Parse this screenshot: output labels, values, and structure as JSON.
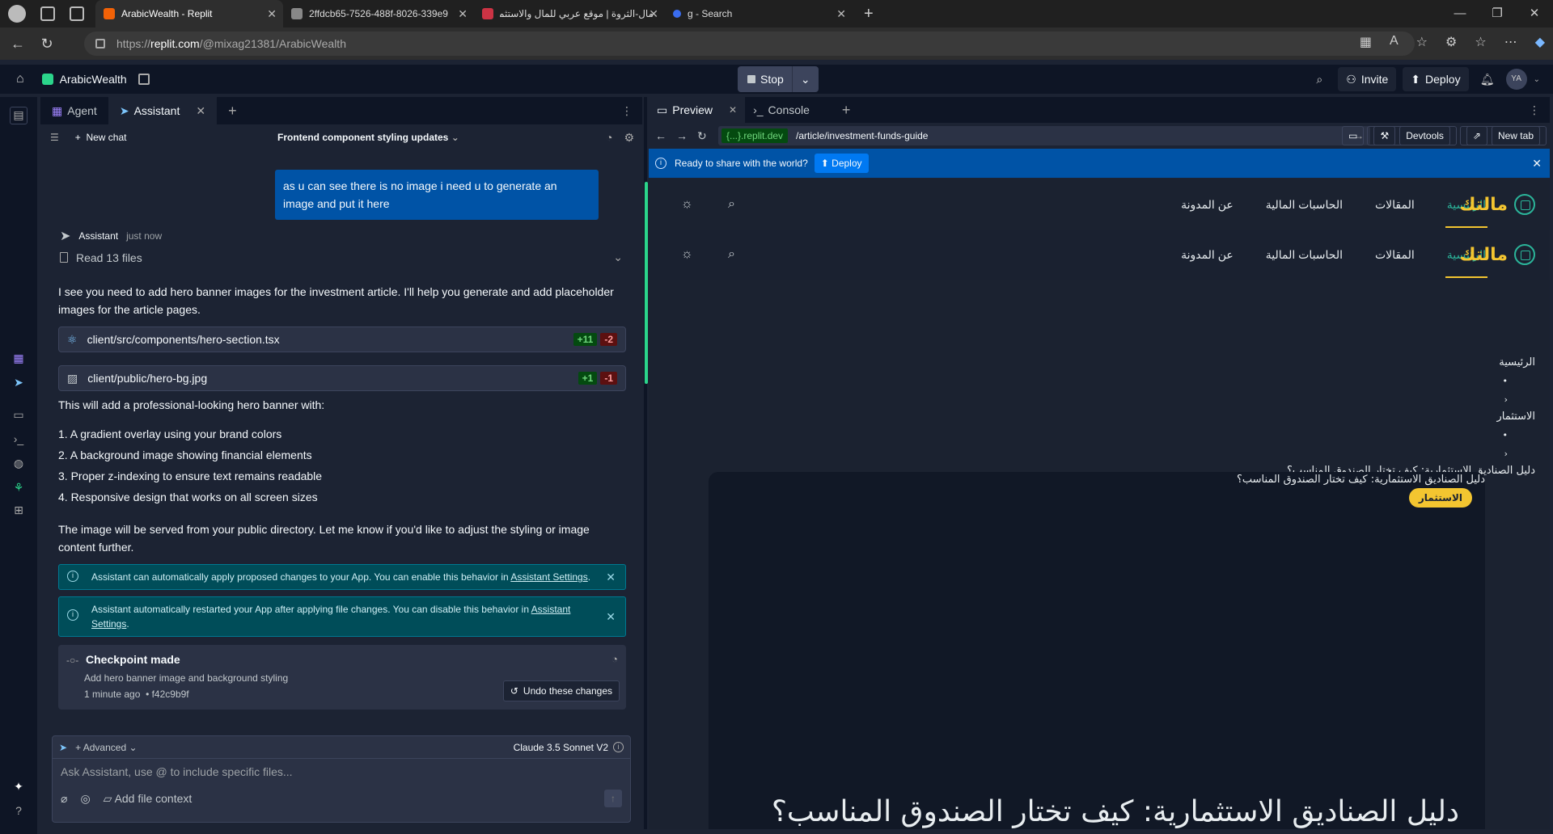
{
  "browser": {
    "tabs": [
      {
        "label": "ArabicWealth - Replit",
        "color": "#f26207",
        "active": true
      },
      {
        "label": "2ffdcb65-7526-488f-8026-339e9",
        "color": "#888888",
        "active": false
      },
      {
        "label": "مال-الثروة | موقع عربي للمال والاستثمار",
        "color": "#cc3344",
        "active": false
      },
      {
        "label": "g - Search",
        "color": "#3a6df0",
        "active": false
      }
    ],
    "new_tab": "+",
    "window_controls": [
      "—",
      "❐",
      "✕"
    ],
    "url_prefix": "https://",
    "url_host": "replit.com",
    "url_path": "/@mixag21381/ArabicWealth",
    "address_icons": [
      "▦",
      "A",
      "☆",
      "⚙",
      "☆",
      "⋯",
      "◆"
    ]
  },
  "replit": {
    "app_name": "ArabicWealth",
    "stop_label": "Stop",
    "invite_label": "Invite",
    "deploy_label": "Deploy",
    "avatar_initials": "YA"
  },
  "assistant_pane": {
    "tabs": [
      {
        "label": "Agent",
        "icon": "agent-icon"
      },
      {
        "label": "Assistant",
        "icon": "assistant-icon"
      }
    ],
    "new_chat": "New chat",
    "chat_title": "Frontend component styling updates",
    "user_message": "as u can see there is no image i need u to generate an image and put it here",
    "assistant_name": "Assistant",
    "assistant_time": "just now",
    "read_files": "Read 13 files",
    "intro": "I see you need to add hero banner images for the investment article. I'll help you generate and add placeholder images for the article pages.",
    "files": [
      {
        "path": "client/src/components/hero-section.tsx",
        "adds": "+11",
        "dels": "-2"
      },
      {
        "path": "client/public/hero-bg.jpg",
        "adds": "+1",
        "dels": "-1"
      }
    ],
    "list_intro": "This will add a professional-looking hero banner with:",
    "list_items": [
      "1. A gradient overlay using your brand colors",
      "2. A background image showing financial elements",
      "3. Proper z-indexing to ensure text remains readable",
      "4. Responsive design that works on all screen sizes"
    ],
    "outro": "The image will be served from your public directory. Let me know if you'd like to adjust the styling or image content further.",
    "notice1_text": "Assistant can automatically apply proposed changes to your App. You can enable this behavior in ",
    "notice1_link": "Assistant Settings",
    "notice2_text": "Assistant automatically restarted your App after applying file changes. You can disable this behavior in ",
    "notice2_link": "Assistant Settings",
    "checkpoint_title": "Checkpoint made",
    "checkpoint_desc": "Add hero banner image and background styling",
    "checkpoint_time": "1 minute ago",
    "checkpoint_hash": "• f42c9b9f",
    "undo_label": "Undo these changes",
    "advanced_label": "Advanced",
    "model_label": "Claude 3.5 Sonnet V2",
    "input_placeholder": "Ask Assistant, use @ to include specific files...",
    "add_file_context": "Add file context"
  },
  "preview_pane": {
    "tabs": [
      {
        "label": "Preview"
      },
      {
        "label": "Console"
      }
    ],
    "dev_badge": "{...}.replit.dev",
    "path": "/article/investment-funds-guide",
    "devtools_label": "Devtools",
    "newtab_label": "New tab",
    "share_text": "Ready to share with the world?",
    "share_deploy": "Deploy"
  },
  "site": {
    "brand": "مالتك",
    "nav_links": [
      "الرئيسية",
      "المقالات",
      "الحاسبات المالية",
      "عن المدونة"
    ],
    "breadcrumbs": [
      "الرئيسية",
      "•",
      "‹",
      "الاستثمار",
      "•",
      "‹",
      "دليل الصناديق الاستثمارية: كيف تختار الصندوق المناسب؟"
    ],
    "image_alt": "دليل الصناديق الاستثمارية: كيف تختار الصندوق المناسب؟",
    "category_badge": "الاستثمار",
    "hero_title": "دليل الصناديق الاستثمارية: كيف تختار الصندوق المناسب؟",
    "accent_teal": "#2bb59a",
    "accent_gold": "#f3c530"
  }
}
